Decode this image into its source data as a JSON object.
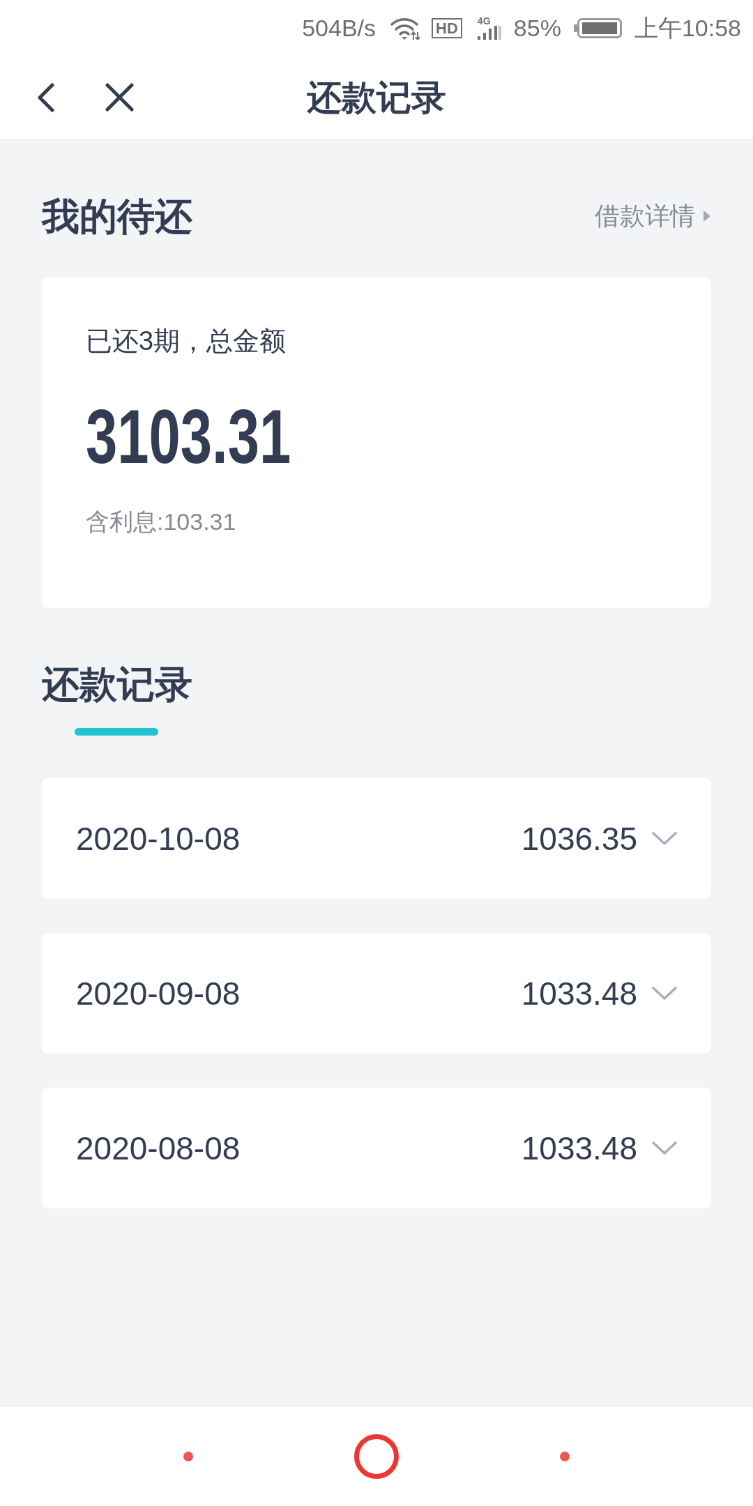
{
  "status_bar": {
    "network_speed": "504B/s",
    "hd_label": "HD",
    "network_type": "4G",
    "battery": "85%",
    "time": "上午10:58"
  },
  "header": {
    "title": "还款记录"
  },
  "pending": {
    "title": "我的待还",
    "details_link": "借款详情",
    "summary": "已还3期，总金额",
    "total_amount": "3103.31",
    "interest": "含利息:103.31"
  },
  "records": {
    "title": "还款记录",
    "items": [
      {
        "date": "2020-10-08",
        "amount": "1036.35",
        "expanded": false
      },
      {
        "date": "2020-09-08",
        "amount": "1033.48",
        "expanded": false
      },
      {
        "date": "2020-08-08",
        "amount": "1033.48",
        "expanded": false
      }
    ]
  }
}
